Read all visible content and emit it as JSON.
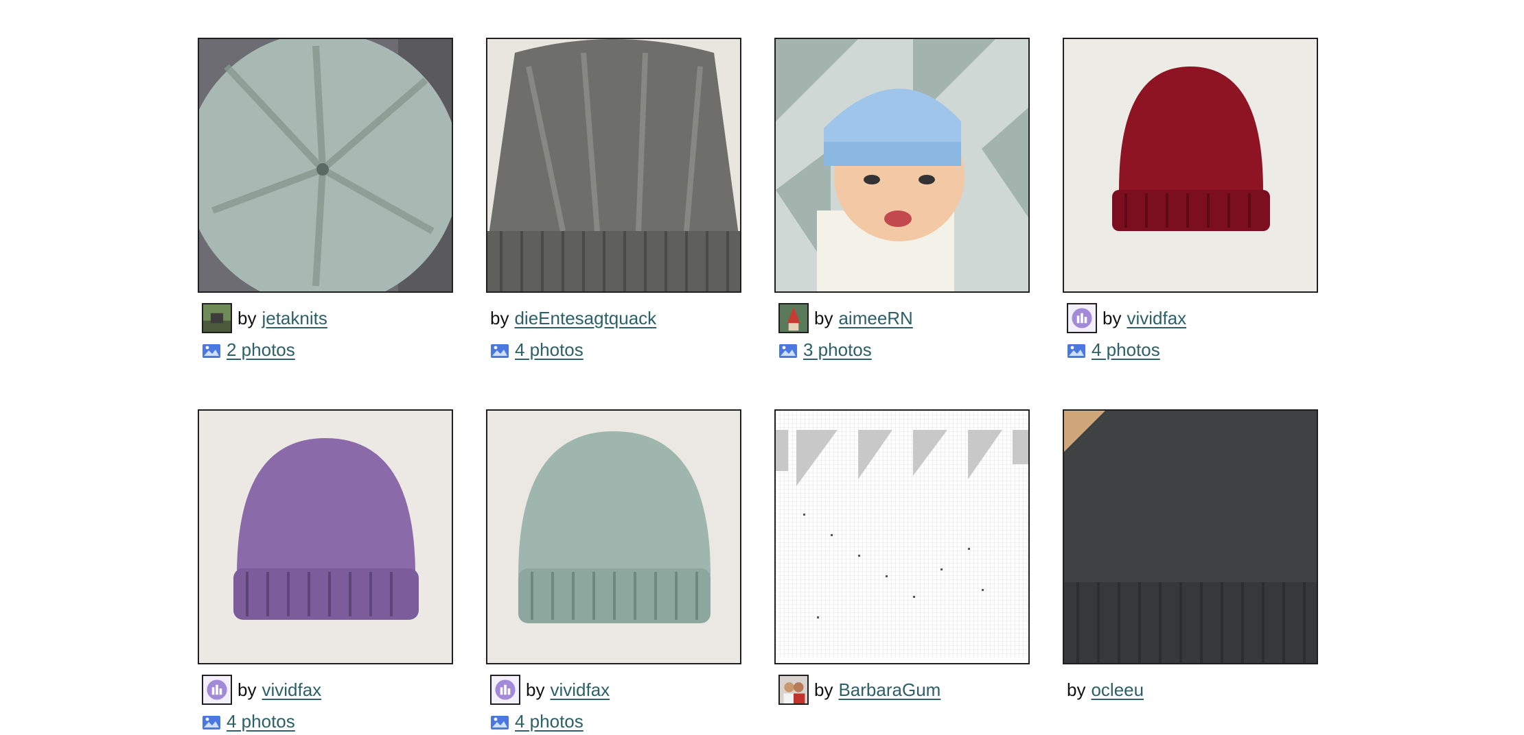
{
  "projects": [
    {
      "by": "by",
      "user": "jetaknits",
      "photos": "2 photos",
      "has_avatar": true,
      "has_photos": true,
      "image": "hat-light-green-top"
    },
    {
      "by": "by",
      "user": "dieEntesagtquack",
      "photos": "4 photos",
      "has_avatar": false,
      "has_photos": true,
      "image": "hat-gray"
    },
    {
      "by": "by",
      "user": "aimeeRN",
      "photos": "3 photos",
      "has_avatar": true,
      "has_photos": true,
      "image": "baby-doll-blue-hat"
    },
    {
      "by": "by",
      "user": "vividfax",
      "photos": "4 photos",
      "has_avatar": true,
      "has_photos": true,
      "image": "hat-red"
    },
    {
      "by": "by",
      "user": "vividfax",
      "photos": "4 photos",
      "has_avatar": true,
      "has_photos": true,
      "image": "hat-purple"
    },
    {
      "by": "by",
      "user": "vividfax",
      "photos": "4 photos",
      "has_avatar": true,
      "has_photos": true,
      "image": "hat-sage"
    },
    {
      "by": "by",
      "user": "BarbaraGum",
      "photos": "",
      "has_avatar": true,
      "has_photos": false,
      "image": "knitting-chart"
    },
    {
      "by": "by",
      "user": "ocleeu",
      "photos": "",
      "has_avatar": false,
      "has_photos": false,
      "image": "hat-charcoal"
    }
  ],
  "colors": {
    "link": "#2c5f67",
    "border": "#1f1f1f",
    "photos_icon": "#4a78e0"
  }
}
